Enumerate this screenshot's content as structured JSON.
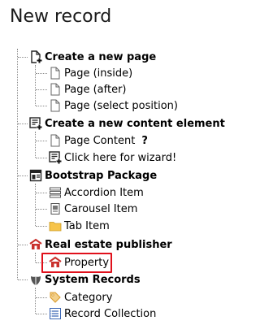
{
  "page": {
    "title": "New record"
  },
  "colors": {
    "highlight": "#e0101b",
    "folder": "#f7c44a",
    "realestate": "#c9302c",
    "category": "#d99a2b",
    "collection": "#3a66b5"
  },
  "groups": [
    {
      "label": "Create a new page",
      "icon": "new-page-icon",
      "items": [
        {
          "label": "Page (inside)",
          "icon": "page-icon"
        },
        {
          "label": "Page (after)",
          "icon": "page-icon"
        },
        {
          "label": "Page (select position)",
          "icon": "page-icon"
        }
      ]
    },
    {
      "label": "Create a new content element",
      "icon": "new-content-element-icon",
      "items": [
        {
          "label": "Page Content",
          "icon": "page-icon",
          "help": "?"
        },
        {
          "label": "Click here for wizard!",
          "icon": "wizard-icon"
        }
      ]
    },
    {
      "label": "Bootstrap Package",
      "icon": "bootstrap-package-icon",
      "items": [
        {
          "label": "Accordion Item",
          "icon": "accordion-icon"
        },
        {
          "label": "Carousel Item",
          "icon": "carousel-icon"
        },
        {
          "label": "Tab Item",
          "icon": "folder-icon"
        }
      ]
    },
    {
      "label": "Real estate publisher",
      "icon": "real-estate-publisher-icon",
      "items": [
        {
          "label": "Property",
          "icon": "property-icon",
          "highlighted": true
        }
      ]
    },
    {
      "label": "System Records",
      "icon": "system-records-icon",
      "items": [
        {
          "label": "Category",
          "icon": "category-icon"
        },
        {
          "label": "Record Collection",
          "icon": "record-collection-icon"
        }
      ]
    }
  ]
}
